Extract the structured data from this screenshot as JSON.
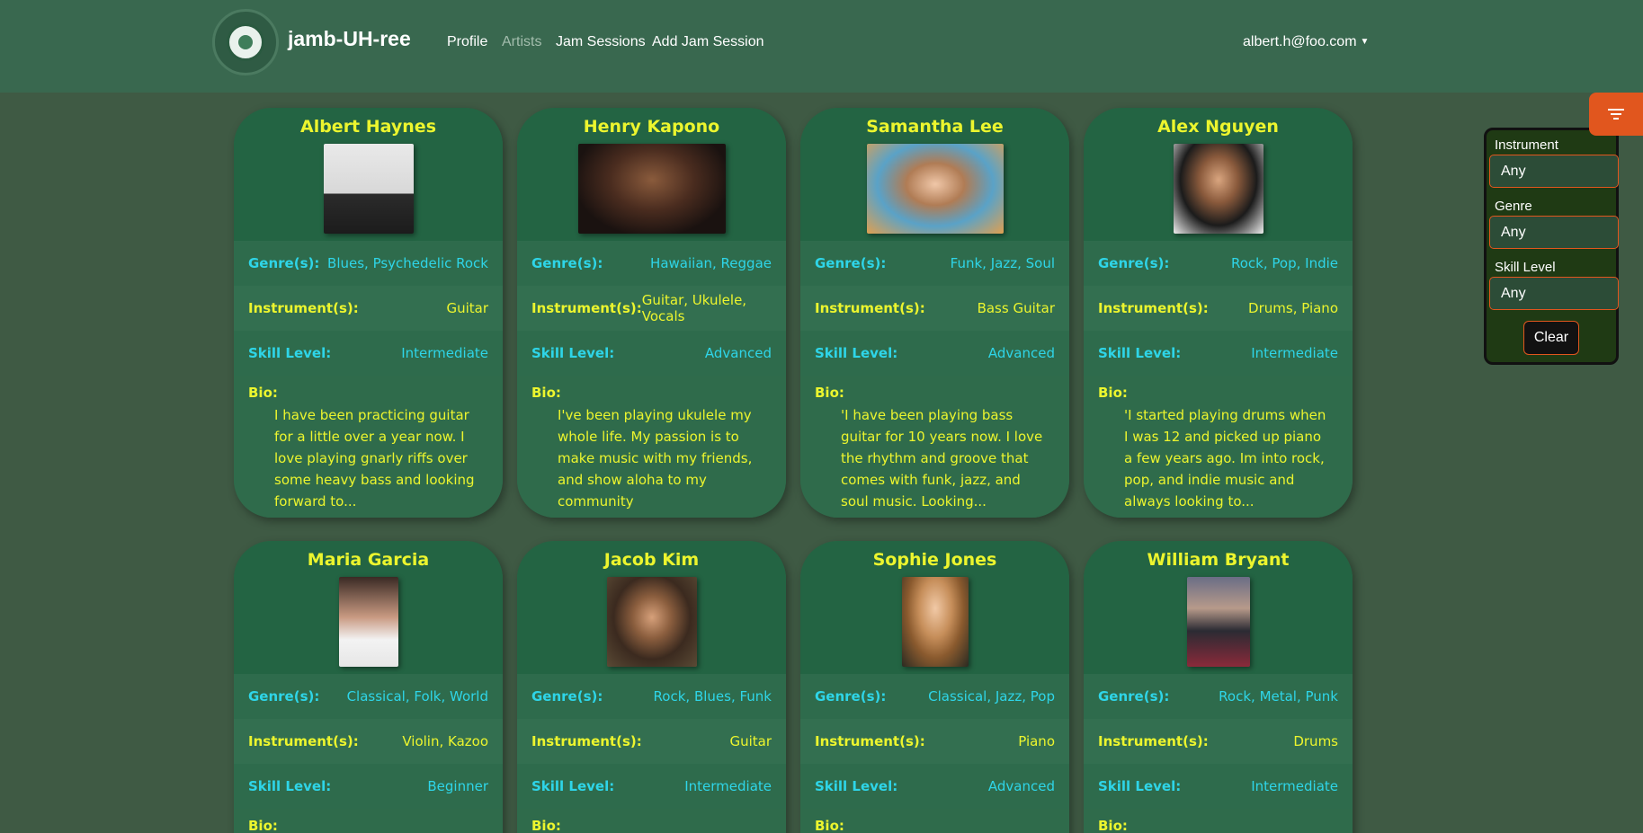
{
  "navbar": {
    "brand": "jamb-UH-ree",
    "links": [
      {
        "label": "Profile"
      },
      {
        "label": "Artists"
      },
      {
        "label": "Jam Sessions"
      },
      {
        "label": "Add Jam Session"
      }
    ],
    "user": "albert.h@foo.com"
  },
  "field_labels": {
    "genre": "Genre(s):",
    "instrument": "Instrument(s):",
    "skill": "Skill Level:",
    "bio": "Bio:"
  },
  "artists": [
    {
      "name": "Albert Haynes",
      "genres": "Blues, Psychedelic Rock",
      "instruments": "Guitar",
      "skill": "Intermediate",
      "bio": "I have been practicing guitar for a little over a year now. I love playing gnarly riffs over some heavy bass and looking forward to..."
    },
    {
      "name": "Henry Kapono",
      "genres": "Hawaiian, Reggae",
      "instruments": "Guitar, Ukulele, Vocals",
      "skill": "Advanced",
      "bio": "I've been playing ukulele my whole life. My passion is to make music with my friends, and show aloha to my community"
    },
    {
      "name": "Samantha Lee",
      "genres": "Funk, Jazz, Soul",
      "instruments": "Bass Guitar",
      "skill": "Advanced",
      "bio": "'I have been playing bass guitar for 10 years now. I love the rhythm and groove that comes with funk, jazz, and soul music. Looking..."
    },
    {
      "name": "Alex Nguyen",
      "genres": "Rock, Pop, Indie",
      "instruments": "Drums, Piano",
      "skill": "Intermediate",
      "bio": "'I started playing drums when I was 12 and picked up piano a few years ago. Im into rock, pop, and indie music and always looking to..."
    },
    {
      "name": "Maria Garcia",
      "genres": "Classical, Folk, World",
      "instruments": "Violin, Kazoo",
      "skill": "Beginner",
      "bio": ""
    },
    {
      "name": "Jacob Kim",
      "genres": "Rock, Blues, Funk",
      "instruments": "Guitar",
      "skill": "Intermediate",
      "bio": ""
    },
    {
      "name": "Sophie Jones",
      "genres": "Classical, Jazz, Pop",
      "instruments": "Piano",
      "skill": "Advanced",
      "bio": ""
    },
    {
      "name": "William Bryant",
      "genres": "Rock, Metal, Punk",
      "instruments": "Drums",
      "skill": "Intermediate",
      "bio": ""
    }
  ],
  "filter": {
    "instrument_label": "Instrument",
    "instrument_value": "Any",
    "genre_label": "Genre",
    "genre_value": "Any",
    "skill_label": "Skill Level",
    "skill_value": "Any",
    "clear_label": "Clear"
  },
  "colors": {
    "background": "#3f5a44",
    "navbar": "#39684f",
    "card": "#2f6b4b",
    "name_yellow": "#ecf52e",
    "cyan": "#2ed5e8",
    "filter_accent": "#e1561e"
  }
}
